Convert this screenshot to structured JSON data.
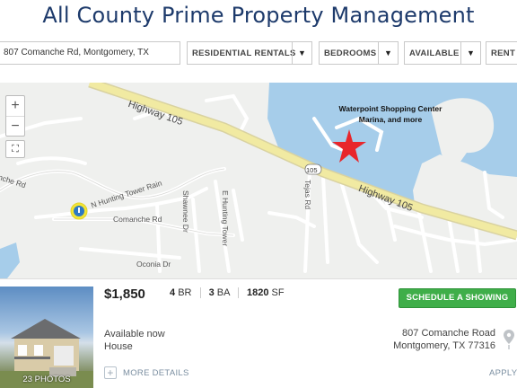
{
  "header": {
    "title": "All County Prime Property Management"
  },
  "filters": {
    "address_value": "807 Comanche Rd, Montgomery, TX",
    "type_label": "RESIDENTIAL RENTALS",
    "bedrooms_label": "BEDROOMS",
    "availability_label": "AVAILABLE",
    "rent_label": "RENT"
  },
  "map": {
    "callout_line1": "Waterpoint Shopping Center",
    "callout_line2": "Marina, and more",
    "highway_label": "Highway 105",
    "highway_label_2": "Highway 105",
    "highway_shield": "105",
    "streets": {
      "comanche": "Comanche Rd",
      "n_hunting": "N Hunting Tower Rain",
      "shawnee": "Shawnee Dr",
      "e_hunting": "E Hunting Tower",
      "tejas": "Tejas Rd",
      "nche": "nche Rd",
      "oconia": "Oconia Dr"
    },
    "zoom_in": "+",
    "zoom_out": "−",
    "fullscreen_icon": "⛶"
  },
  "listing": {
    "price": "$1,850",
    "beds_value": "4",
    "beds_unit": "BR",
    "baths_value": "3",
    "baths_unit": "BA",
    "sqft_value": "1820",
    "sqft_unit": "SF",
    "availability": "Available now",
    "property_type": "House",
    "address_line1": "807 Comanche Road",
    "address_line2": "Montgomery, TX 77316",
    "photo_count": "23 PHOTOS",
    "schedule_label": "SCHEDULE A SHOWING",
    "more_details_label": "MORE DETAILS",
    "apply_label": "APPLY",
    "more_icon": "+"
  },
  "colors": {
    "title": "#1d3a6b",
    "schedule_button": "#3fae49",
    "water": "#a6cdea",
    "highway": "#f1eaa2",
    "marker_star": "#e8262b",
    "property_marker": "#f3e535"
  }
}
